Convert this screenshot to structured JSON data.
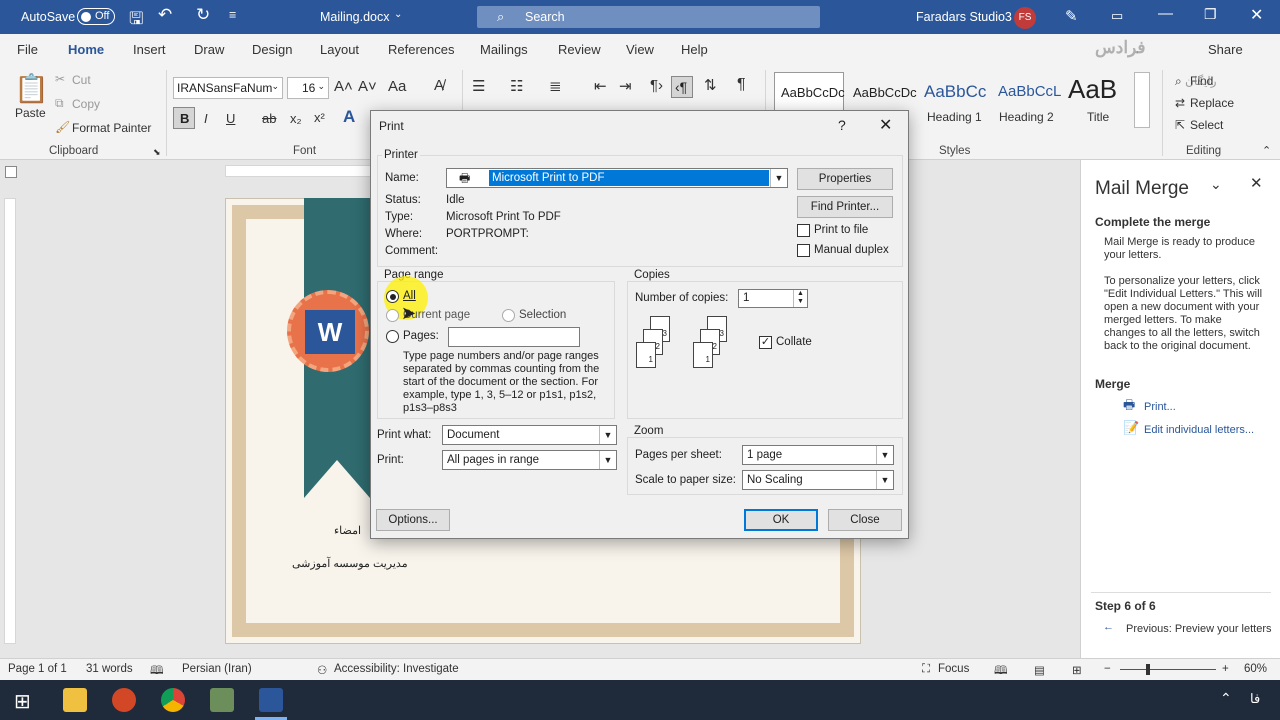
{
  "titlebar": {
    "autosave_label": "AutoSave",
    "autosave_state": "Off",
    "doc_title": "Mailing.docx",
    "search_placeholder": "Search",
    "user_name": "Faradars Studio3",
    "user_initials": "FS"
  },
  "menu": {
    "items": [
      "File",
      "Home",
      "Insert",
      "Draw",
      "Design",
      "Layout",
      "References",
      "Mailings",
      "Review",
      "View",
      "Help"
    ],
    "share": "Share"
  },
  "ribbon": {
    "clipboard": {
      "paste": "Paste",
      "cut": "Cut",
      "copy": "Copy",
      "format_painter": "Format Painter",
      "group_label": "Clipboard"
    },
    "font": {
      "name": "IRANSansFaNum",
      "size": "16",
      "group_label": "Font",
      "bold": "B",
      "italic": "I",
      "underline": "U",
      "strike": "ab",
      "sub": "x₂",
      "sup": "x²"
    },
    "styles": {
      "items": [
        "AaBbCcDc",
        "AaBbCcDc",
        "AaBbCc",
        "AaBbCcL",
        "AaB"
      ],
      "names": [
        "",
        "",
        "Heading 1",
        "Heading 2",
        "Title"
      ],
      "group_label": "Styles"
    },
    "editing": {
      "find": "Find",
      "replace": "Replace",
      "select": "Select",
      "group_label": "Editing"
    }
  },
  "document": {
    "signature_label": "امضاء",
    "signer": "مدیریت موسسه آموزشی",
    "logo_letter": "W"
  },
  "print_dialog": {
    "title": "Print",
    "help": "?",
    "printer": {
      "section": "Printer",
      "name_label": "Name:",
      "name_value": "Microsoft Print to PDF",
      "status_label": "Status:",
      "status_value": "Idle",
      "type_label": "Type:",
      "type_value": "Microsoft Print To PDF",
      "where_label": "Where:",
      "where_value": "PORTPROMPT:",
      "comment_label": "Comment:",
      "properties_button": "Properties",
      "find_printer_button": "Find Printer...",
      "print_to_file": "Print to file",
      "manual_duplex": "Manual duplex"
    },
    "page_range": {
      "section": "Page range",
      "all": "All",
      "current_page": "Current page",
      "selection": "Selection",
      "pages": "Pages:",
      "help_text": "Type page numbers and/or page ranges separated by commas counting from the start of the document or the section. For example, type 1, 3, 5–12 or p1s1, p1s2, p1s3–p8s3"
    },
    "copies": {
      "section": "Copies",
      "number_label": "Number of copies:",
      "number_value": "1",
      "collate": "Collate",
      "collate_checked": true,
      "page_labels": [
        "3",
        "2",
        "1",
        "3",
        "2",
        "1"
      ]
    },
    "print_what_label": "Print what:",
    "print_what_value": "Document",
    "print_label": "Print:",
    "print_value": "All pages in range",
    "zoom": {
      "section": "Zoom",
      "pages_per_sheet_label": "Pages per sheet:",
      "pages_per_sheet_value": "1 page",
      "scale_label": "Scale to paper size:",
      "scale_value": "No Scaling"
    },
    "options_button": "Options...",
    "ok_button": "OK",
    "close_button": "Close"
  },
  "mail_merge": {
    "title": "Mail Merge",
    "complete_heading": "Complete the merge",
    "ready_text": "Mail Merge is ready to produce your letters.",
    "personalize_text": "To personalize your letters, click \"Edit Individual Letters.\" This will open a new document with your merged letters. To make changes to all the letters, switch back to the original document.",
    "merge_heading": "Merge",
    "print_link": "Print...",
    "edit_link": "Edit individual letters...",
    "step": "Step 6 of 6",
    "previous_link": "Previous: Preview your letters"
  },
  "status_bar": {
    "page": "Page 1 of 1",
    "words": "31 words",
    "language": "Persian (Iran)",
    "accessibility": "Accessibility: Investigate",
    "focus": "Focus",
    "zoom": "60%"
  },
  "watermark": {
    "brand": "فرادس",
    "sub": "رایگان"
  },
  "taskbar": {
    "lang": "فا"
  },
  "colors": {
    "accent": "#2b579a",
    "selection": "#0078d7"
  }
}
